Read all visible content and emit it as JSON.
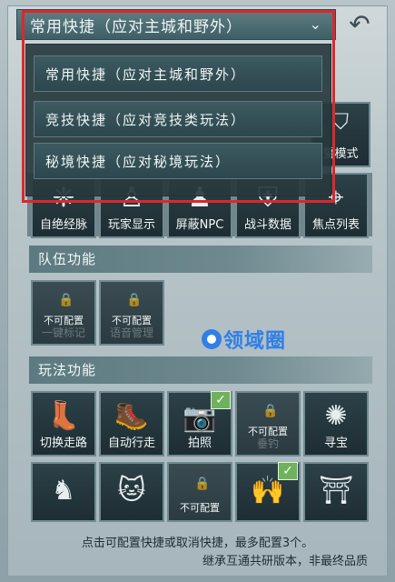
{
  "top_selector": {
    "selected": "常用快捷（应对主城和野外）"
  },
  "dropdown": {
    "options": [
      "常用快捷（应对主城和野外）",
      "竞技快捷（应对竞技类玩法）",
      "秘境快捷（应对秘境玩法）"
    ]
  },
  "row1": {
    "partial_label": "誓模式",
    "labels": [
      "自绝经脉",
      "玩家显示",
      "屏蔽NPC",
      "战斗数据",
      "焦点列表"
    ]
  },
  "team": {
    "header": "队伍功能",
    "locked_label": "不可配置",
    "tiles": [
      "一键标记",
      "语音管理"
    ]
  },
  "play": {
    "header": "玩法功能",
    "tiles": [
      "切换走路",
      "自动行走",
      "拍照",
      "垂钓",
      "寻宝"
    ],
    "locked_label": "不可配置"
  },
  "watermark": "领域圈",
  "footer": {
    "hint": "点击可配置快捷或取消快捷，最多配置3个。",
    "version": "继承互通共研版本，非最终品质"
  },
  "colors": {
    "highlight": "#e0262a",
    "check": "#6fb25c",
    "watermark": "#2f7fe6"
  }
}
